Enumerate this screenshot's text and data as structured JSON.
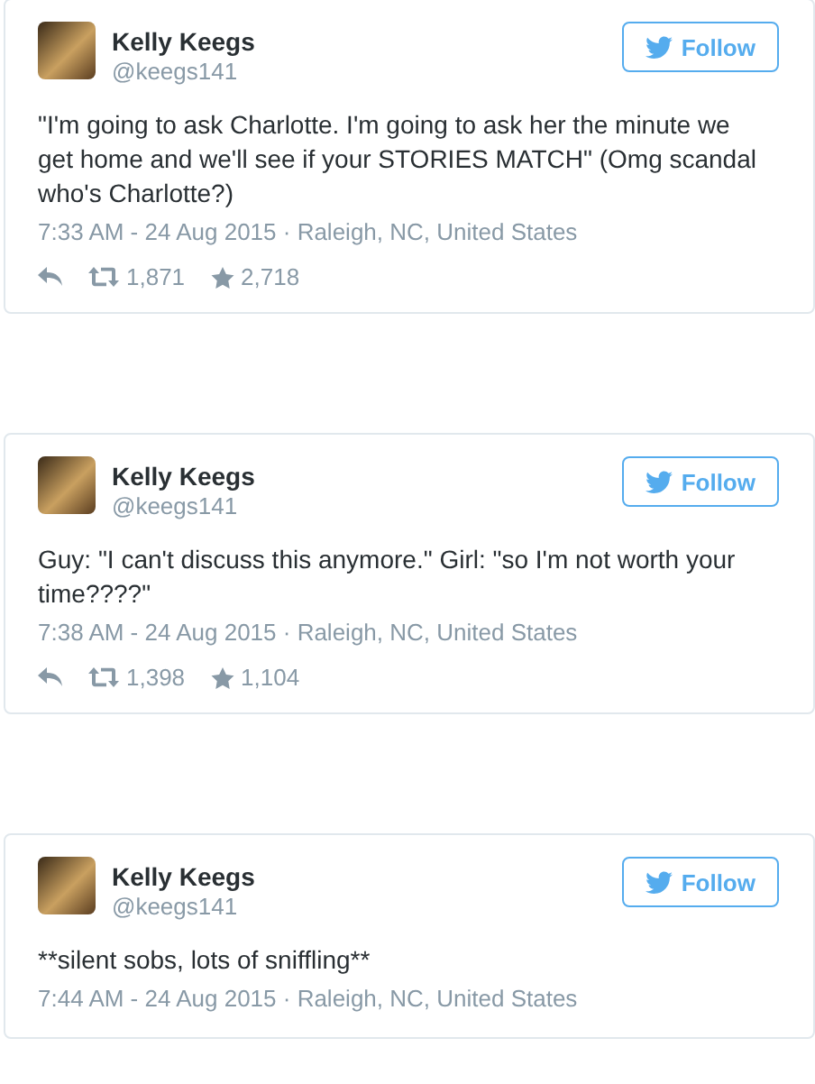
{
  "tweets": [
    {
      "name": "Kelly Keegs",
      "handle": "@keegs141",
      "follow": "Follow",
      "text": "\"I'm going to ask Charlotte. I'm going to ask her the minute we get home and we'll see if your STORIES MATCH\" (Omg scandal who's Charlotte?)",
      "meta": "7:33 AM - 24 Aug 2015 · Raleigh, NC, United States",
      "retweets": "1,871",
      "likes": "2,718"
    },
    {
      "name": "Kelly Keegs",
      "handle": "@keegs141",
      "follow": "Follow",
      "text": "Guy: \"I can't discuss this anymore.\" Girl: \"so I'm not worth your time????\"",
      "meta": "7:38 AM - 24 Aug 2015 · Raleigh, NC, United States",
      "retweets": "1,398",
      "likes": "1,104"
    },
    {
      "name": "Kelly Keegs",
      "handle": "@keegs141",
      "follow": "Follow",
      "text": "**silent sobs, lots of sniffling**",
      "meta": "7:44 AM - 24 Aug 2015 · Raleigh, NC, United States"
    }
  ]
}
